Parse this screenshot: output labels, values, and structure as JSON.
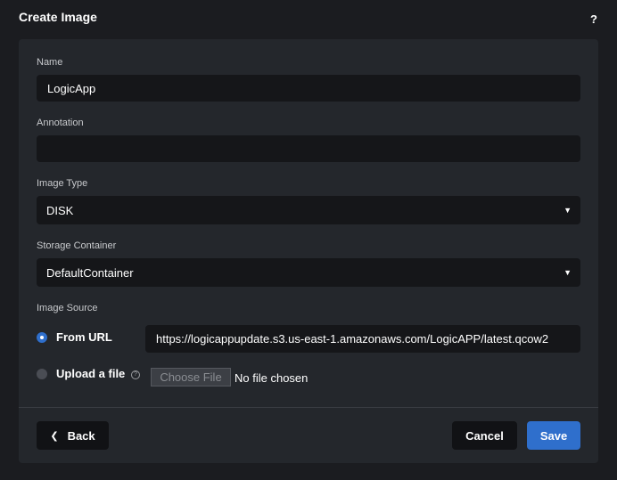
{
  "dialog": {
    "title": "Create Image",
    "help_label": "?"
  },
  "form": {
    "name": {
      "label": "Name",
      "value": "LogicApp"
    },
    "annotation": {
      "label": "Annotation",
      "value": ""
    },
    "image_type": {
      "label": "Image Type",
      "value": "DISK"
    },
    "storage_container": {
      "label": "Storage Container",
      "value": "DefaultContainer"
    },
    "image_source": {
      "label": "Image Source",
      "from_url_label": "From URL",
      "from_url_selected": true,
      "url_value": "https://logicappupdate.s3.us-east-1.amazonaws.com/LogicAPP/latest.qcow2",
      "upload_label": "Upload a file",
      "choose_file_label": "Choose File",
      "no_file_text": "No file chosen"
    }
  },
  "footer": {
    "back_label": "Back",
    "cancel_label": "Cancel",
    "save_label": "Save"
  },
  "colors": {
    "accent": "#2f6fcc",
    "background": "#1b1c20",
    "panel": "#24272c",
    "input": "#151619"
  }
}
